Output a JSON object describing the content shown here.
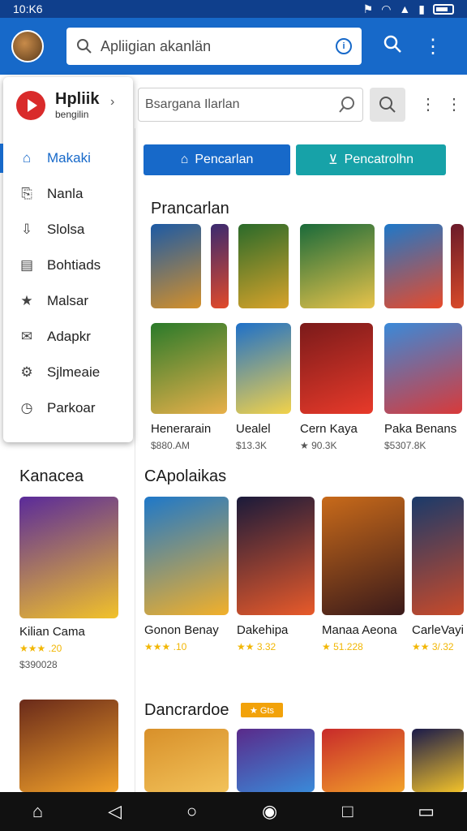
{
  "status_bar": {
    "time": "10:K6"
  },
  "top_search": {
    "placeholder": "Apliigian akanlän"
  },
  "main_search": {
    "placeholder": "Bsargana Ilarlan"
  },
  "tabs": [
    {
      "label": "Pencarlan"
    },
    {
      "label": "Pencatrolhn"
    }
  ],
  "drawer": {
    "title": "Hpliik",
    "subtitle": "bengilin",
    "items": [
      {
        "label": "Makaki",
        "icon": "home-icon"
      },
      {
        "label": "Nanla",
        "icon": "bookmark-icon"
      },
      {
        "label": "Slolsa",
        "icon": "download-icon"
      },
      {
        "label": "Bohtiads",
        "icon": "library-icon"
      },
      {
        "label": "Malsar",
        "icon": "star-icon"
      },
      {
        "label": "Adapkr",
        "icon": "mail-icon"
      },
      {
        "label": "Sjlmeaie",
        "icon": "settings-icon"
      },
      {
        "label": "Parkoar",
        "icon": "clock-icon"
      }
    ]
  },
  "sections": {
    "first": {
      "title": "Prancarlan"
    },
    "left": {
      "title": "Kanacea"
    },
    "second": {
      "title": "CApolaikas"
    },
    "third": {
      "title": "Dancrardoe",
      "badge": "★ Gts"
    }
  },
  "row1": [
    {
      "colors": [
        "#1c5aa5",
        "#d4902a"
      ]
    },
    {
      "colors": [
        "#3a2a70",
        "#e24a2a"
      ]
    },
    {
      "colors": [
        "#2a6a2a",
        "#d8a32a"
      ]
    },
    {
      "colors": [
        "#1a6a3a",
        "#e8c34a"
      ]
    },
    {
      "colors": [
        "#1e78c9",
        "#e84a2a"
      ]
    },
    {
      "colors": [
        "#6a1a2a",
        "#d84a2a"
      ]
    }
  ],
  "row2": [
    {
      "name": "Henerarain",
      "meta": "$880.AM",
      "colors": [
        "#2a7a2a",
        "#e8b04a"
      ]
    },
    {
      "name": "Uealel",
      "meta": "$13.3K",
      "colors": [
        "#1e70c9",
        "#f2d24a"
      ]
    },
    {
      "name": "Cern Kaya",
      "meta": "★ 90.3K",
      "colors": [
        "#7a1a1a",
        "#e83a2a"
      ]
    },
    {
      "name": "Paka Benans",
      "meta": "$5307.8K",
      "colors": [
        "#3a8ad9",
        "#d83a3a"
      ]
    }
  ],
  "left_card": {
    "name": "Kilian Cama",
    "rating": "★★★ .20",
    "meta": "$390028",
    "colors": [
      "#5a2a9a",
      "#f2c22a"
    ]
  },
  "left_card2": {
    "colors": [
      "#6a2a1a",
      "#f2a22a"
    ]
  },
  "row3": [
    {
      "name": "Gonon Benay",
      "rating": "★★★ .10",
      "colors": [
        "#1e78c9",
        "#f2b02a"
      ]
    },
    {
      "name": "Dakehipa",
      "rating": "★★ 3.32",
      "colors": [
        "#1a1a3a",
        "#e85a2a"
      ]
    },
    {
      "name": "Manaa Aeona",
      "rating": "★ 51.228",
      "colors": [
        "#c86a1a",
        "#3a1a1a"
      ]
    },
    {
      "name": "CarleVayi",
      "rating": "★★ 3/.32",
      "colors": [
        "#1a3a6a",
        "#c84a2a"
      ]
    }
  ],
  "row4": [
    {
      "colors": [
        "#d8902a",
        "#f2c25a"
      ]
    },
    {
      "colors": [
        "#5a2a8a",
        "#3a8ad9"
      ]
    },
    {
      "colors": [
        "#c82a2a",
        "#f2a22a"
      ]
    },
    {
      "colors": [
        "#1a1a4a",
        "#f2c22a"
      ]
    }
  ]
}
